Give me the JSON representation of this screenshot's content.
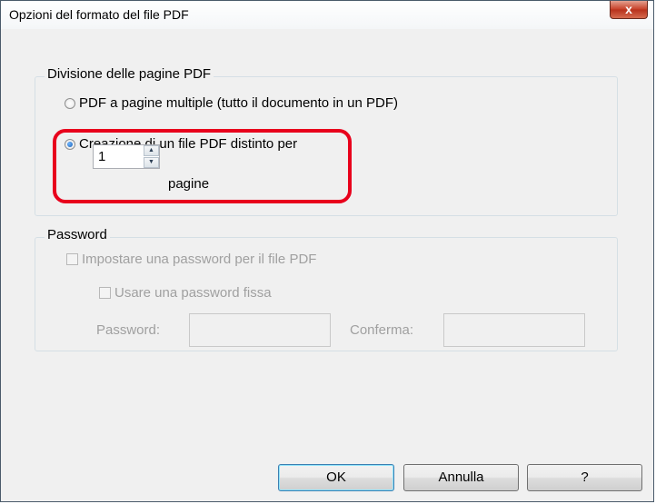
{
  "window": {
    "title": "Opzioni del formato del file PDF",
    "close_glyph": "x"
  },
  "division_group": {
    "label": "Divisione delle pagine PDF",
    "options": [
      {
        "label": "PDF a pagine multiple (tutto il documento in un PDF)",
        "checked": false
      },
      {
        "label": "Creazione di un file PDF distinto per",
        "checked": true
      }
    ],
    "pages_value": "1",
    "pages_label": "pagine"
  },
  "password_group": {
    "label": "Password",
    "set_password_label": "Impostare una password per il file PDF",
    "fixed_password_label": "Usare una password fissa",
    "password_label": "Password:",
    "confirm_label": "Conferma:",
    "enabled": false
  },
  "buttons": {
    "ok": "OK",
    "cancel": "Annulla",
    "help": "?"
  },
  "colors": {
    "highlight": "#e8001c",
    "disabled_text": "#a0a0a0"
  }
}
